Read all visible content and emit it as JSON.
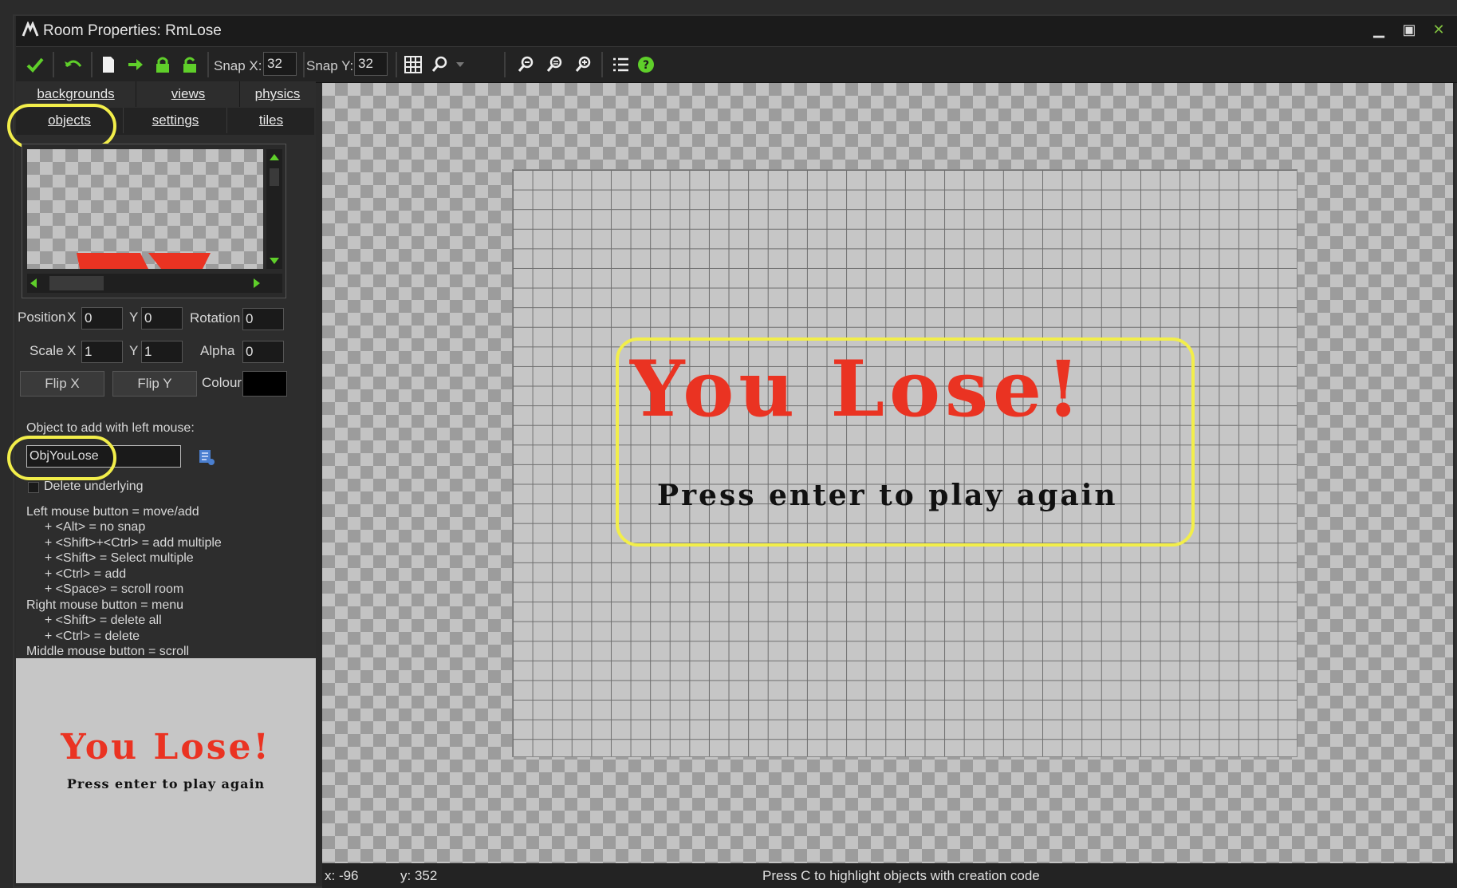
{
  "window": {
    "title": "Room Properties: RmLose",
    "minimize_glyph": "▁",
    "maximize_glyph": "▣",
    "close_glyph": "✕"
  },
  "toolbar": {
    "snap_x_label": "Snap X:",
    "snap_x_value": "32",
    "snap_y_label": "Snap Y:",
    "snap_y_value": "32"
  },
  "tabs": {
    "row1": [
      "backgrounds",
      "views",
      "physics"
    ],
    "row2": [
      "objects",
      "settings",
      "tiles"
    ],
    "active": "objects"
  },
  "object_props": {
    "position_label": "Position",
    "x_label": "X",
    "y_label": "Y",
    "position_x": "0",
    "position_y": "0",
    "rotation_label": "Rotation",
    "rotation_value": "0",
    "scale_label": "Scale",
    "scale_x": "1",
    "scale_y": "1",
    "alpha_label": "Alpha",
    "alpha_value": "0",
    "flip_x_label": "Flip X",
    "flip_y_label": "Flip Y",
    "colour_label": "Colour",
    "colour_value": "#000000"
  },
  "object_select": {
    "label": "Object to add with left mouse:",
    "value": "ObjYouLose",
    "delete_underlying_label": "Delete underlying"
  },
  "help": [
    "Left mouse button = move/add",
    "  + <Alt> = no snap",
    "  + <Shift>+<Ctrl> = add multiple",
    "  + <Shift> = Select multiple",
    "  + <Ctrl> = add",
    "  + <Space> = scroll room",
    "Right mouse button = menu",
    "  + <Shift> = delete all",
    "  + <Ctrl> = delete",
    "Middle mouse button = scroll"
  ],
  "room_text": {
    "title": "You Lose!",
    "subtitle": "Press enter to play again"
  },
  "status": {
    "x": "x: -96",
    "y": "y: 352",
    "hint": "Press C to highlight objects with creation code"
  },
  "colors": {
    "accent_green": "#4fbf2a",
    "lose_red": "#ea3322",
    "highlight_yellow": "#f2ee4a"
  }
}
